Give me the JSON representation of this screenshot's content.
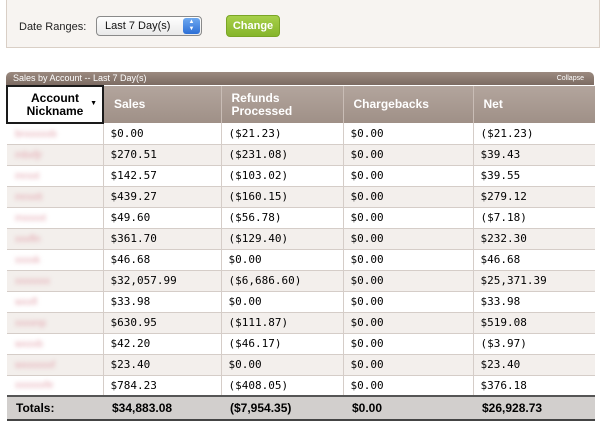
{
  "filter": {
    "label": "Date Ranges:",
    "selected_range": "Last 7 Day(s)",
    "change_label": "Change"
  },
  "panel": {
    "title": "Sales by Account -- Last 7 Day(s)",
    "collapse_label": "Collapse"
  },
  "table": {
    "headers": {
      "account": "Account\nNickname",
      "sales": "Sales",
      "refunds": "Refunds\nProcessed",
      "chargebacks": "Chargebacks",
      "net": "Net"
    },
    "rows": [
      {
        "name": "",
        "sales": "$0.00",
        "refunds": "($21.23)",
        "chargebacks": "$0.00",
        "net": "($21.23)"
      },
      {
        "name": "",
        "sales": "$270.51",
        "refunds": "($231.08)",
        "chargebacks": "$0.00",
        "net": "$39.43"
      },
      {
        "name": "",
        "sales": "$142.57",
        "refunds": "($103.02)",
        "chargebacks": "$0.00",
        "net": "$39.55"
      },
      {
        "name": "",
        "sales": "$439.27",
        "refunds": "($160.15)",
        "chargebacks": "$0.00",
        "net": "$279.12"
      },
      {
        "name": "",
        "sales": "$49.60",
        "refunds": "($56.78)",
        "chargebacks": "$0.00",
        "net": "($7.18)"
      },
      {
        "name": "",
        "sales": "$361.70",
        "refunds": "($129.40)",
        "chargebacks": "$0.00",
        "net": "$232.30"
      },
      {
        "name": "",
        "sales": "$46.68",
        "refunds": "$0.00",
        "chargebacks": "$0.00",
        "net": "$46.68"
      },
      {
        "name": "",
        "sales": "$32,057.99",
        "refunds": "($6,686.60)",
        "chargebacks": "$0.00",
        "net": "$25,371.39"
      },
      {
        "name": "",
        "sales": "$33.98",
        "refunds": "$0.00",
        "chargebacks": "$0.00",
        "net": "$33.98"
      },
      {
        "name": "",
        "sales": "$630.95",
        "refunds": "($111.87)",
        "chargebacks": "$0.00",
        "net": "$519.08"
      },
      {
        "name": "",
        "sales": "$42.20",
        "refunds": "($46.17)",
        "chargebacks": "$0.00",
        "net": "($3.97)"
      },
      {
        "name": "",
        "sales": "$23.40",
        "refunds": "$0.00",
        "chargebacks": "$0.00",
        "net": "$23.40"
      },
      {
        "name": "",
        "sales": "$784.23",
        "refunds": "($408.05)",
        "chargebacks": "$0.00",
        "net": "$376.18"
      }
    ],
    "totals": {
      "label": "Totals:",
      "sales": "$34,883.08",
      "refunds": "($7,954.35)",
      "chargebacks": "$0.00",
      "net": "$26,928.73"
    }
  },
  "colors": {
    "header_bar": "#8c7b72",
    "button_green": "#94c23a",
    "redacted_name": "#e3a5ae"
  }
}
